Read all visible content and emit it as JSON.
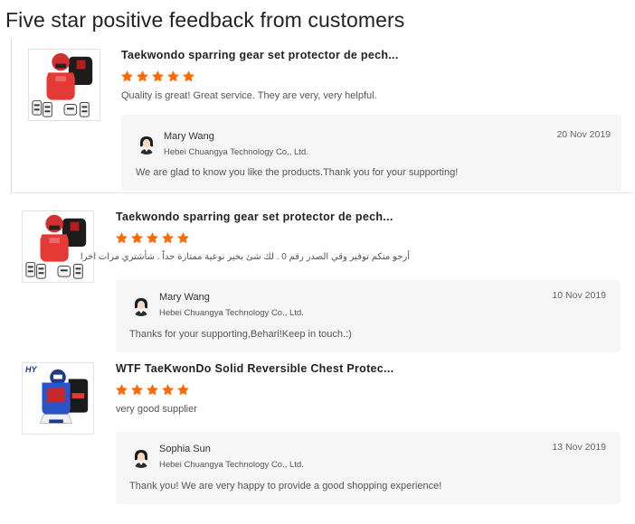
{
  "page": {
    "title": "Five star positive feedback from customers"
  },
  "colors": {
    "star": "#ff6a00",
    "reply_bg": "#f6f6f6",
    "title_text": "#222222"
  },
  "reviews": [
    {
      "product_title": "Taekwondo sparring gear set protector de pech...",
      "thumbnail": "taekwondo-gear-set-image",
      "rating": 5,
      "comment": "Quality is great! Great service. They are very, very helpful.",
      "reply": {
        "avatar": "female-avatar-icon",
        "name": "Mary Wang",
        "company": "Hebei Chuangya Technology Co., Ltd.",
        "date": "20 Nov 2019",
        "text": "We are glad to know you like the products.Thank you for your supporting!"
      }
    },
    {
      "product_title": "Taekwondo sparring gear set protector de pech...",
      "thumbnail": "taekwondo-gear-set-image",
      "rating": 5,
      "comment": "أرجو منكم توفير وقي الصدر رقم 0 . لك شئ بخير نوعية ممتازة جداً . شأشتري مرات اخرا",
      "reply": {
        "avatar": "female-avatar-icon",
        "name": "Mary Wang",
        "company": "Hebei Chuangya Technology Co., Ltd.",
        "date": "10 Nov 2019",
        "text": "Thanks for your supporting,Behari!Keep in touch.:)"
      }
    },
    {
      "product_title": "WTF TaeKwonDo Solid Reversible Chest Protec...",
      "thumbnail": "wtf-chest-protector-image",
      "thumb_logo": "HY",
      "rating": 5,
      "comment": "very good supplier",
      "reply": {
        "avatar": "female-avatar-icon",
        "name": "Sophia Sun",
        "company": "Hebei Chuangya Technology Co., Ltd.",
        "date": "13 Nov 2019",
        "text": "Thank you! We are very happy to provide a good shopping experience!"
      }
    }
  ]
}
